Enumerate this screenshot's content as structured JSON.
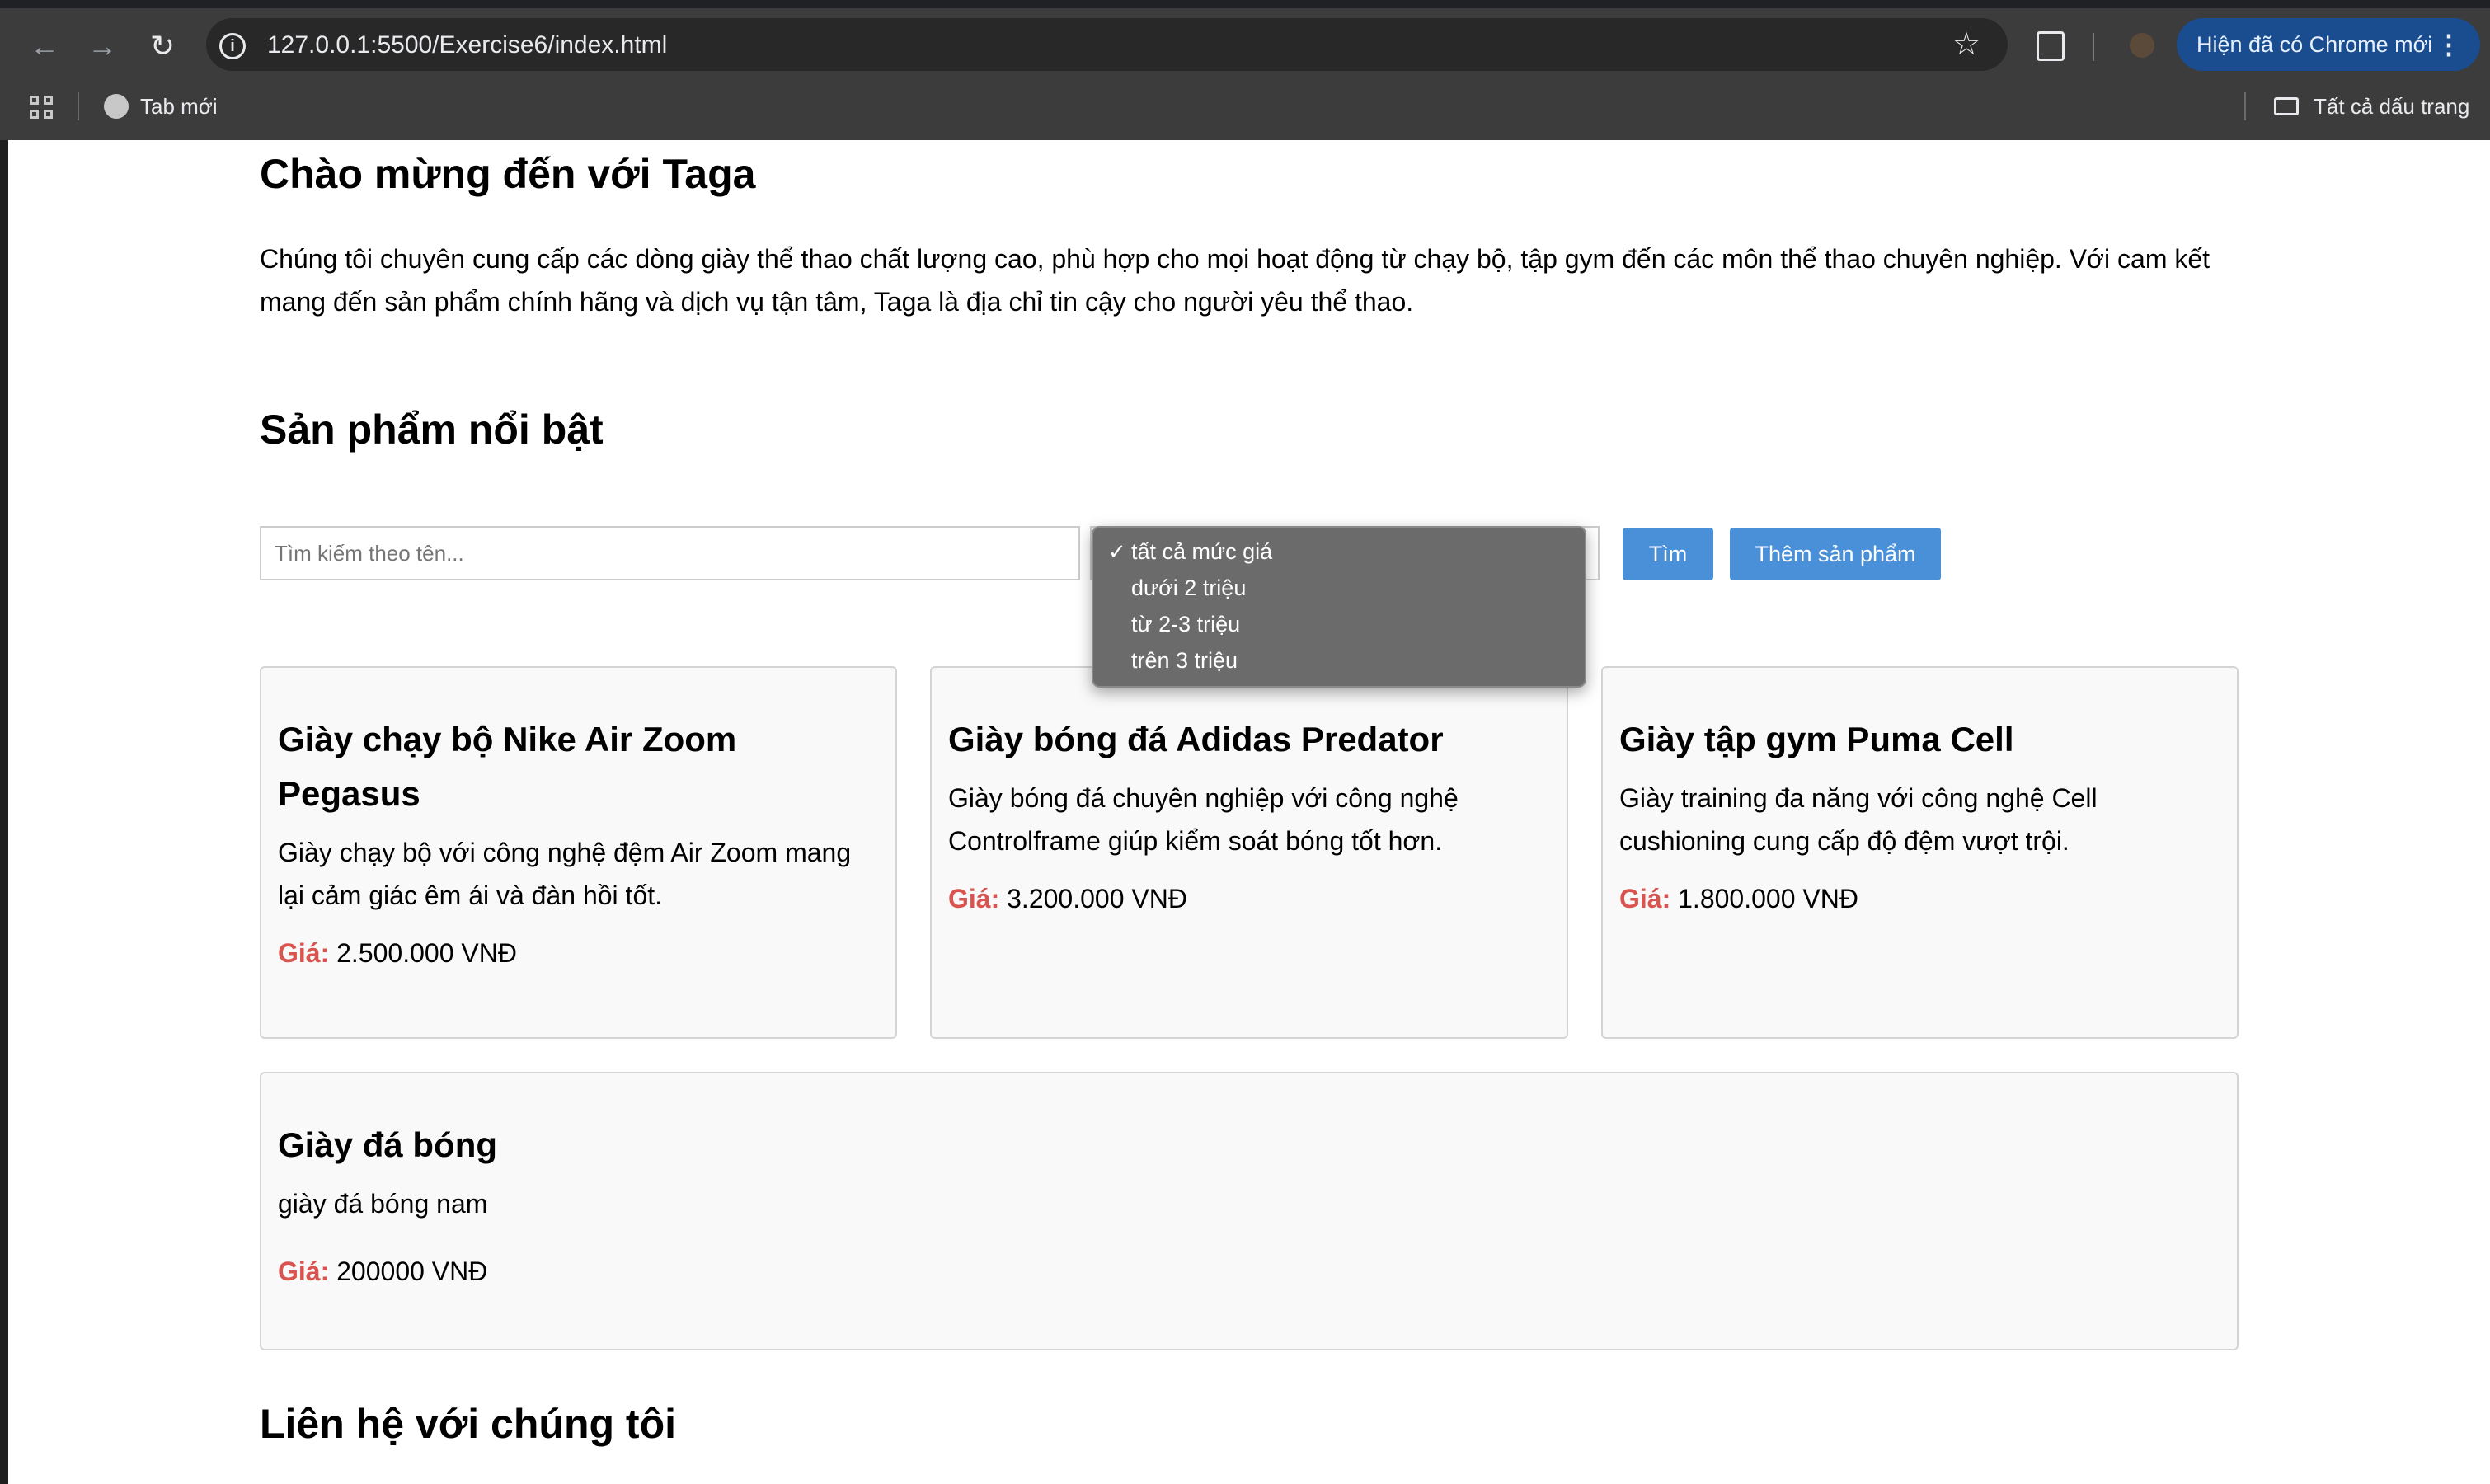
{
  "browser": {
    "url": "127.0.0.1:5500/Exercise6/index.html",
    "update_label": "Hiện đã có Chrome mới",
    "bookmarks": [
      {
        "label": "Tab mới"
      }
    ],
    "all_bookmarks_label": "Tất cả dấu trang"
  },
  "hero": {
    "title": "Chào mừng đến với Taga",
    "text": "Chúng tôi chuyên cung cấp các dòng giày thể thao chất lượng cao, phù hợp cho mọi hoạt động từ chạy bộ, tập gym đến các môn thể thao chuyên nghiệp. Với cam kết mang đến sản phẩm chính hãng và dịch vụ tận tâm, Taga là địa chỉ tin cậy cho người yêu thể thao."
  },
  "products_section": {
    "title": "Sản phẩm nổi bật",
    "search_placeholder": "Tìm kiếm theo tên...",
    "price_filter": {
      "selected": "tất cả mức giá",
      "options": [
        "tất cả mức giá",
        "dưới 2 triệu",
        "từ 2-3 triệu",
        "trên 3 triệu"
      ]
    },
    "search_button": "Tìm",
    "add_button": "Thêm sản phẩm",
    "price_label": "Giá:",
    "products": [
      {
        "name": "Giày chạy bộ Nike Air Zoom Pegasus",
        "description": "Giày chạy bộ với công nghệ đệm Air Zoom mang lại cảm giác êm ái và đàn hồi tốt.",
        "price": "2.500.000 VNĐ"
      },
      {
        "name": "Giày bóng đá Adidas Predator",
        "description": "Giày bóng đá chuyên nghiệp với công nghệ Controlframe giúp kiểm soát bóng tốt hơn.",
        "price": "3.200.000 VNĐ"
      },
      {
        "name": "Giày tập gym Puma Cell",
        "description": "Giày training đa năng với công nghệ Cell cushioning cung cấp độ đệm vượt trội.",
        "price": "1.800.000 VNĐ"
      },
      {
        "name": "Giày đá bóng",
        "description": "giày đá bóng nam",
        "price": "200000 VNĐ"
      }
    ]
  },
  "contact": {
    "title": "Liên hệ với chúng tôi"
  },
  "colors": {
    "accent": "#4a90d9",
    "price_label": "#d9534f",
    "chrome_bg": "#3c3c3c",
    "update_pill": "#1a4d8f"
  }
}
